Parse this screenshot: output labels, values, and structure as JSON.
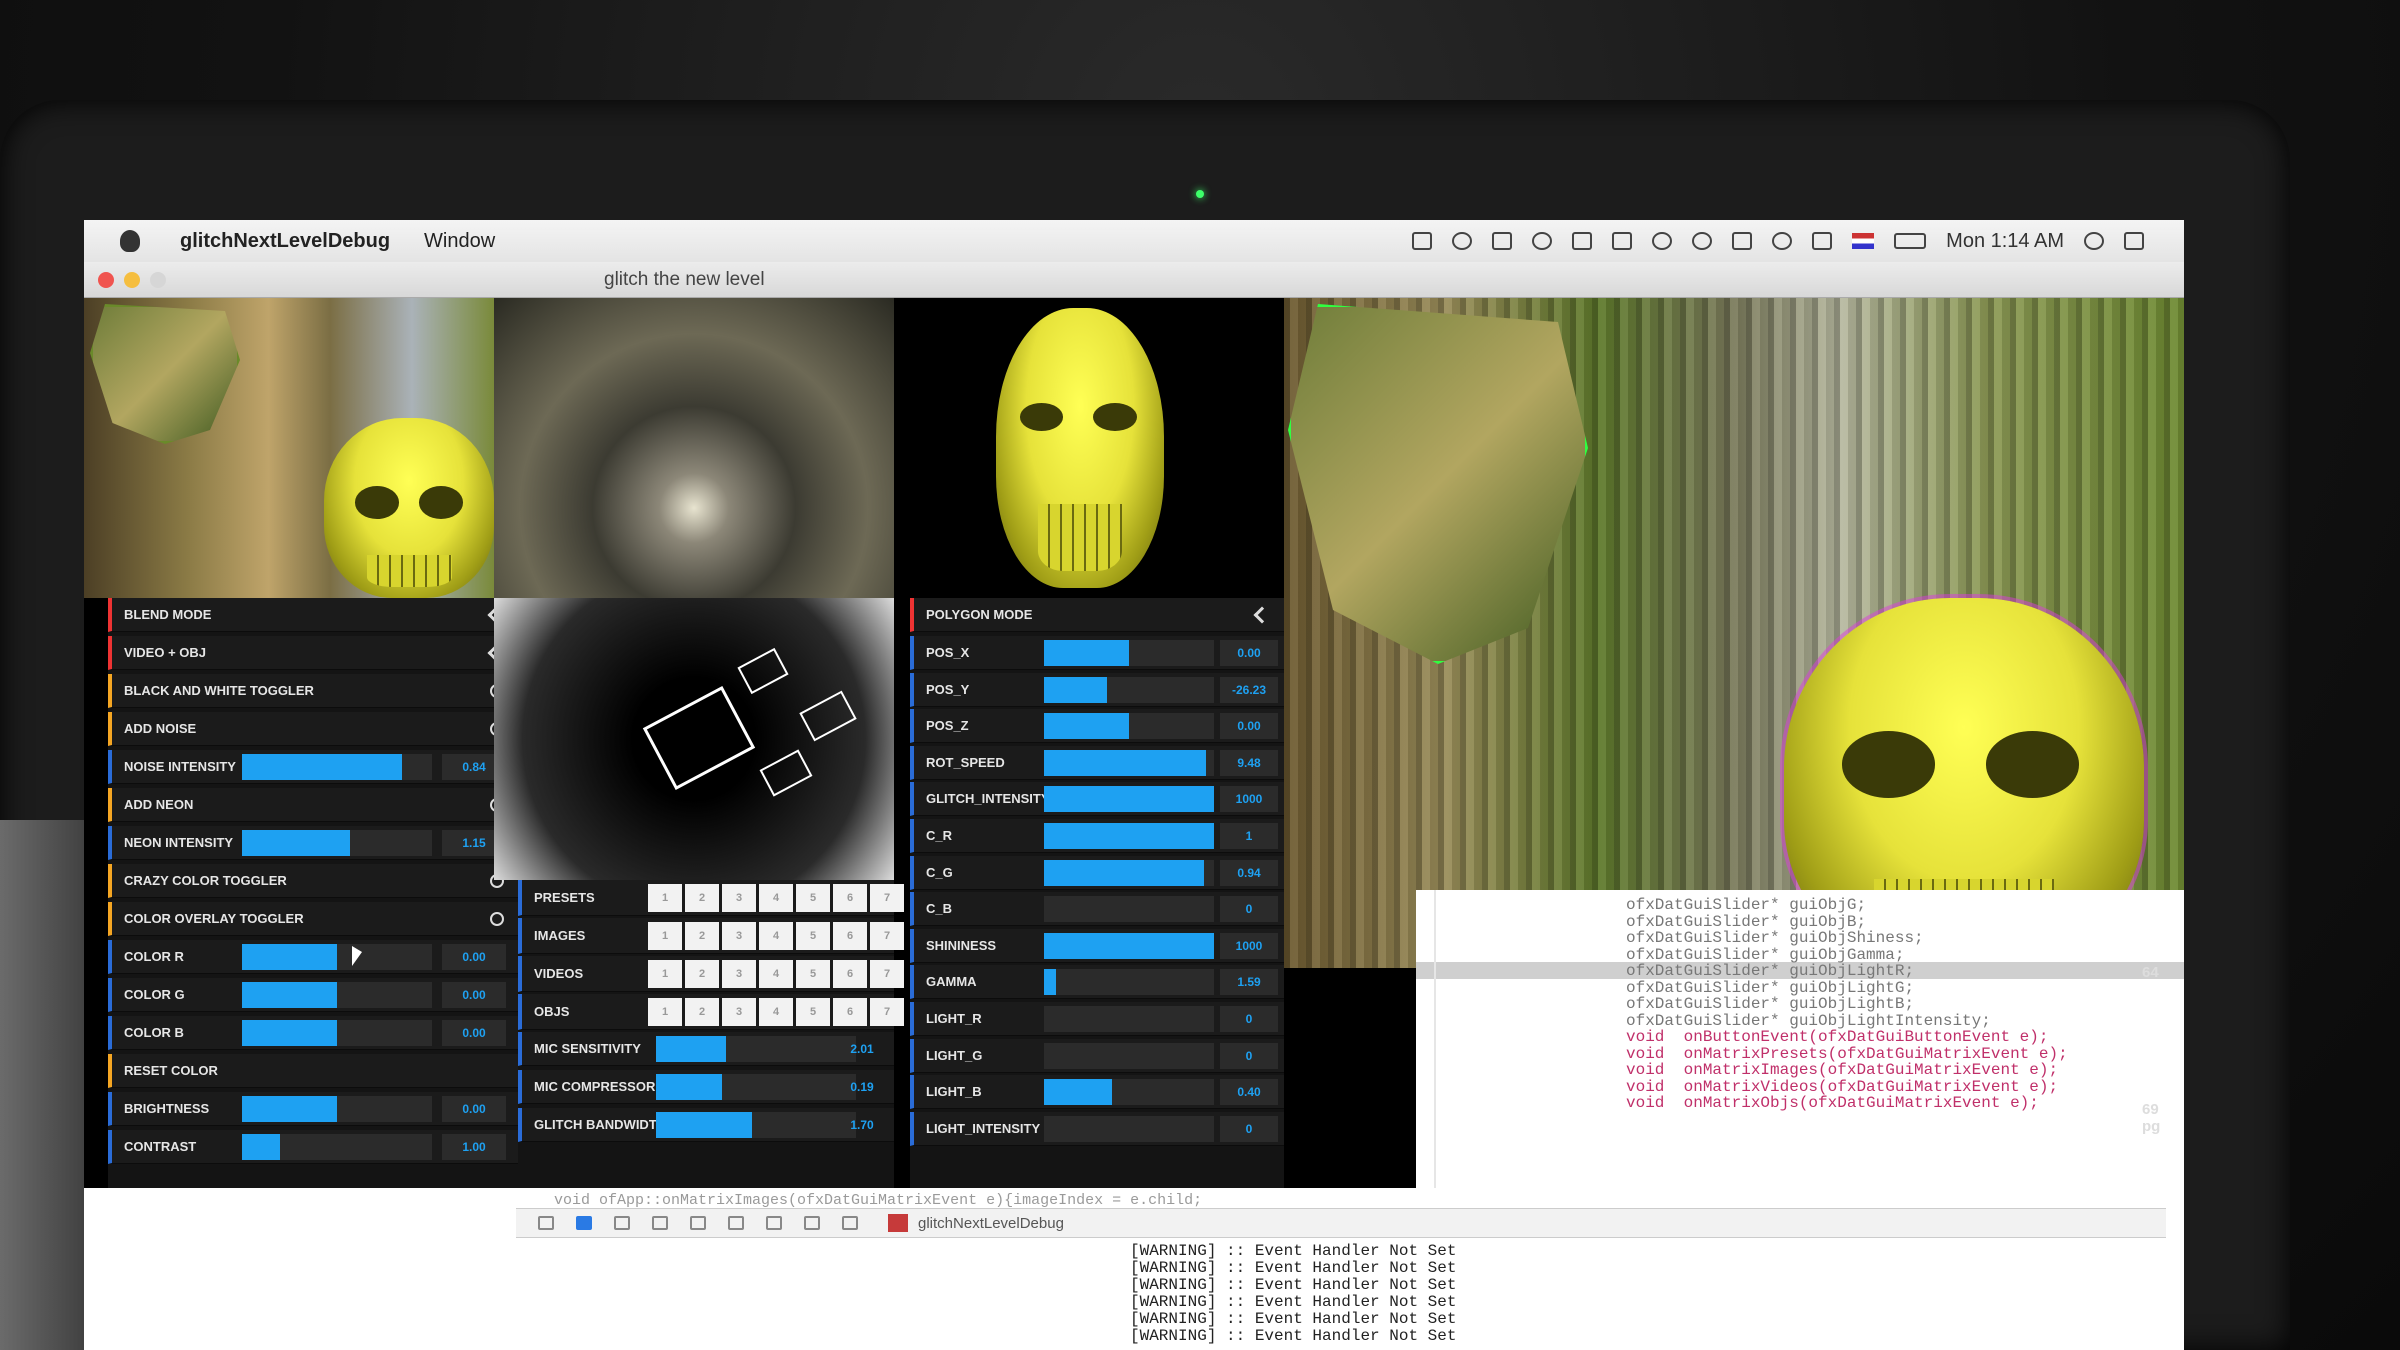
{
  "menubar": {
    "app_name": "glitchNextLevelDebug",
    "menus": [
      "Window"
    ],
    "clock": "Mon 1:14 AM"
  },
  "window": {
    "title": "glitch the new level"
  },
  "left_panel": {
    "dropdowns": [
      {
        "label": "BLEND MODE"
      },
      {
        "label": "VIDEO + OBJ"
      }
    ],
    "toggles": [
      {
        "label": "BLACK AND WHITE TOGGLER",
        "on": false
      },
      {
        "label": "ADD NOISE",
        "on": true
      }
    ],
    "noise_intensity": {
      "label": "NOISE INTENSITY",
      "value": "0.84",
      "fraction": 0.84
    },
    "add_neon": {
      "label": "ADD NEON",
      "on": true
    },
    "neon_intensity": {
      "label": "NEON INTENSITY",
      "value": "1.15",
      "fraction": 0.57
    },
    "crazy_color": {
      "label": "CRAZY COLOR TOGGLER",
      "on": false
    },
    "color_overlay": {
      "label": "COLOR OVERLAY TOGGLER",
      "on": false
    },
    "color_r": {
      "label": "COLOR R",
      "value": "0.00",
      "fraction": 0.5
    },
    "color_g": {
      "label": "COLOR G",
      "value": "0.00",
      "fraction": 0.5
    },
    "color_b": {
      "label": "COLOR B",
      "value": "0.00",
      "fraction": 0.5
    },
    "reset_color": {
      "label": "RESET COLOR"
    },
    "brightness": {
      "label": "BRIGHTNESS",
      "value": "0.00",
      "fraction": 0.5
    },
    "contrast": {
      "label": "CONTRAST",
      "value": "1.00",
      "fraction": 0.2
    }
  },
  "center_panel": {
    "matrices": [
      {
        "label": "PRESETS",
        "cells": [
          "1",
          "2",
          "3",
          "4",
          "5",
          "6",
          "7"
        ]
      },
      {
        "label": "IMAGES",
        "cells": [
          "1",
          "2",
          "3",
          "4",
          "5",
          "6",
          "7"
        ]
      },
      {
        "label": "VIDEOS",
        "cells": [
          "1",
          "2",
          "3",
          "4",
          "5",
          "6",
          "7"
        ]
      },
      {
        "label": "OBJS",
        "cells": [
          "1",
          "2",
          "3",
          "4",
          "5",
          "6",
          "7"
        ]
      }
    ],
    "mic_sensitivity": {
      "label": "MIC SENSITIVITY",
      "value": "2.01",
      "fraction": 0.35
    },
    "mic_compressor": {
      "label": "MIC COMPRESSOR",
      "value": "0.19",
      "fraction": 0.33
    },
    "glitch_bandwidth": {
      "label": "GLITCH BANDWIDTH",
      "value": "1.70",
      "fraction": 0.48
    }
  },
  "right_panel": {
    "polygon_mode": {
      "label": "POLYGON MODE"
    },
    "sliders": [
      {
        "label": "POS_X",
        "value": "0.00",
        "fraction": 0.5
      },
      {
        "label": "POS_Y",
        "value": "-26.23",
        "fraction": 0.37
      },
      {
        "label": "POS_Z",
        "value": "0.00",
        "fraction": 0.5
      },
      {
        "label": "ROT_SPEED",
        "value": "9.48",
        "fraction": 0.95
      },
      {
        "label": "GLITCH_INTENSITY",
        "value": "1000",
        "fraction": 1.0
      },
      {
        "label": "C_R",
        "value": "1",
        "fraction": 1.0
      },
      {
        "label": "C_G",
        "value": "0.94",
        "fraction": 0.94
      },
      {
        "label": "C_B",
        "value": "0",
        "fraction": 0.0
      },
      {
        "label": "SHININESS",
        "value": "1000",
        "fraction": 1.0
      },
      {
        "label": "GAMMA",
        "value": "1.59",
        "fraction": 0.07
      },
      {
        "label": "LIGHT_R",
        "value": "0",
        "fraction": 0.0
      },
      {
        "label": "LIGHT_G",
        "value": "0",
        "fraction": 0.0
      },
      {
        "label": "LIGHT_B",
        "value": "0.40",
        "fraction": 0.4
      },
      {
        "label": "LIGHT_INTENSITY",
        "value": "0",
        "fraction": 0.0
      }
    ]
  },
  "code": [
    {
      "text": "ofxDatGuiSlider* guiObjG;",
      "kw": false
    },
    {
      "text": "ofxDatGuiSlider* guiObjB;",
      "kw": false
    },
    {
      "text": "ofxDatGuiSlider* guiObjShiness;",
      "kw": false
    },
    {
      "text": "ofxDatGuiSlider* guiObjGamma;",
      "kw": false
    },
    {
      "text": "ofxDatGuiSlider* guiObjLightR;",
      "kw": false,
      "sel": true
    },
    {
      "text": "ofxDatGuiSlider* guiObjLightG;",
      "kw": false
    },
    {
      "text": "ofxDatGuiSlider* guiObjLightB;",
      "kw": false
    },
    {
      "text": "ofxDatGuiSlider* guiObjLightIntensity;",
      "kw": false
    },
    {
      "text": "void  onButtonEvent(ofxDatGuiButtonEvent e);",
      "kw": true
    },
    {
      "text": "void  onMatrixPresets(ofxDatGuiMatrixEvent e);",
      "kw": true
    },
    {
      "text": "void  onMatrixImages(ofxDatGuiMatrixEvent e);",
      "kw": true
    },
    {
      "text": "void  onMatrixVideos(ofxDatGuiMatrixEvent e);",
      "kw": true
    },
    {
      "text": "void  onMatrixObjs(ofxDatGuiMatrixEvent e);",
      "kw": true
    }
  ],
  "code_behind": "void ofApp::onMatrixImages(ofxDatGuiMatrixEvent e){imageIndex = e.child;",
  "debug_target": "glitchNextLevelDebug",
  "console": [
    "[WARNING] :: Event Handler Not Set",
    "[WARNING] :: Event Handler Not Set",
    "[WARNING] :: Event Handler Not Set",
    "[WARNING] :: Event Handler Not Set",
    "[WARNING] :: Event Handler Not Set",
    "[WARNING] :: Event Handler Not Set"
  ],
  "edge_text": [
    "64",
    "69",
    "pg"
  ],
  "colors": {
    "accent": "#1ea1f2",
    "skull": "#f2ee2e",
    "glitch_outline": "#30ff40"
  }
}
